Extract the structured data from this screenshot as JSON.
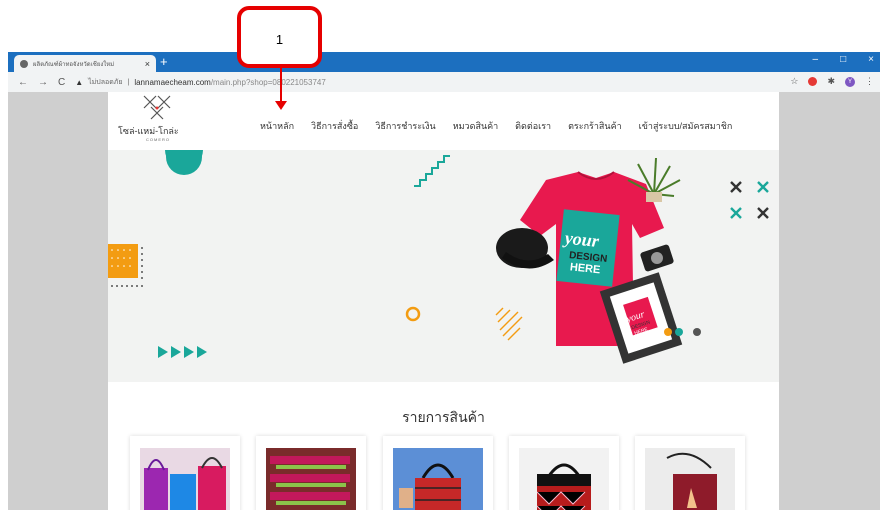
{
  "browser": {
    "tab_title": "ผลิตภัณฑ์ผ้าทอจังหวัดเชียงใหม่",
    "tab_close": "×",
    "new_tab": "+",
    "win_min": "–",
    "win_max": "□",
    "win_close": "×",
    "back": "←",
    "forward": "→",
    "reload": "C",
    "warning_icon": "▲",
    "security_label": "ไม่ปลอดภัย",
    "url_domain": "lannamaecheam.com",
    "url_path": "/main.php?shop=080221053747",
    "ext_avatar": "Y"
  },
  "site": {
    "logo_name": "โซล่-แหม่-โกล่ะ",
    "logo_sub": "COMERO",
    "menu": [
      "หน้าหลัก",
      "วิธีการสั่งซื้อ",
      "วิธีการชำระเงิน",
      "หมวดสินค้า",
      "ติดต่อเรา",
      "ตระกร้าสินค้า",
      "เข้าสู่ระบบ/สมัครสมาชิก"
    ],
    "products_title": "รายการสินค้า"
  },
  "hero": {
    "shirt_text_1": "your",
    "shirt_text_2": "DESIGN",
    "shirt_text_3": "HERE",
    "frame_text_1": "your",
    "frame_text_2": "DESIGN",
    "frame_text_3": "HERE"
  },
  "annotation": {
    "number": "1"
  },
  "colors": {
    "accent_red": "#e60000",
    "titlebar": "#1c6fbf",
    "teal": "#1aa79a",
    "orange": "#f39c12",
    "shirt": "#e8194e"
  }
}
